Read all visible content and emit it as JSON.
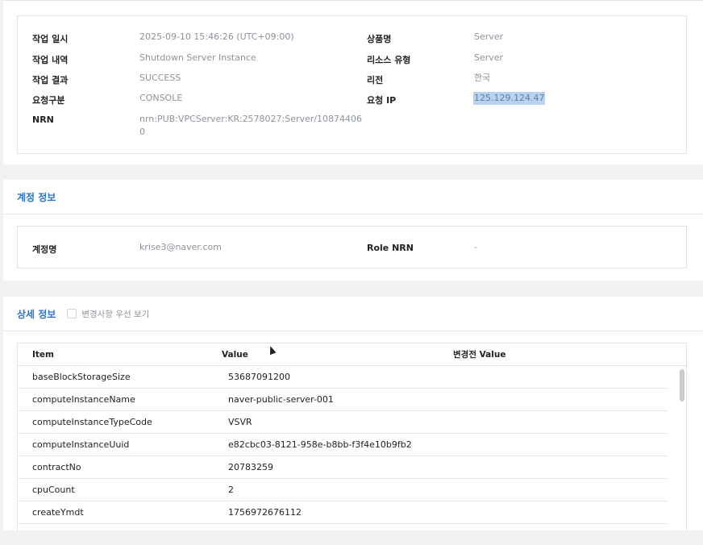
{
  "operation": {
    "left": [
      {
        "label": "작업 일시",
        "value": "2025-09-10 15:46:26 (UTC+09:00)"
      },
      {
        "label": "작업 내역",
        "value": "Shutdown Server Instance"
      },
      {
        "label": "작업 결과",
        "value": "SUCCESS"
      },
      {
        "label": "요청구분",
        "value": "CONSOLE"
      },
      {
        "label": "NRN",
        "value": "nrn:PUB:VPCServer:KR:2578027:Server/10874406",
        "value2": "0"
      }
    ],
    "right": [
      {
        "label": "상품명",
        "value": "Server"
      },
      {
        "label": "리소스 유형",
        "value": "Server"
      },
      {
        "label": "리전",
        "value": "한국"
      },
      {
        "label": "요청 IP",
        "value": "125.129.124.47"
      }
    ]
  },
  "account": {
    "title": "계정 정보",
    "name_label": "계정명",
    "name_value": "krise3@naver.com",
    "role_label": "Role NRN",
    "role_value": "-"
  },
  "detail": {
    "title": "상세 정보",
    "checkbox_label": "변경사항 우선 보기",
    "checkbox_checked": false,
    "columns": {
      "item": "Item",
      "value": "Value",
      "before": "변경전 Value"
    },
    "rows": [
      {
        "item": "baseBlockStorageSize",
        "value": "53687091200",
        "before": ""
      },
      {
        "item": "computeInstanceName",
        "value": "naver-public-server-001",
        "before": ""
      },
      {
        "item": "computeInstanceTypeCode",
        "value": "VSVR",
        "before": ""
      },
      {
        "item": "computeInstanceUuid",
        "value": "e82cbc03-8121-958e-b8bb-f3f4e10b9fb2",
        "before": ""
      },
      {
        "item": "contractNo",
        "value": "20783259",
        "before": ""
      },
      {
        "item": "cpuCount",
        "value": "2",
        "before": ""
      },
      {
        "item": "createYmdt",
        "value": "1756972676112",
        "before": ""
      }
    ]
  }
}
